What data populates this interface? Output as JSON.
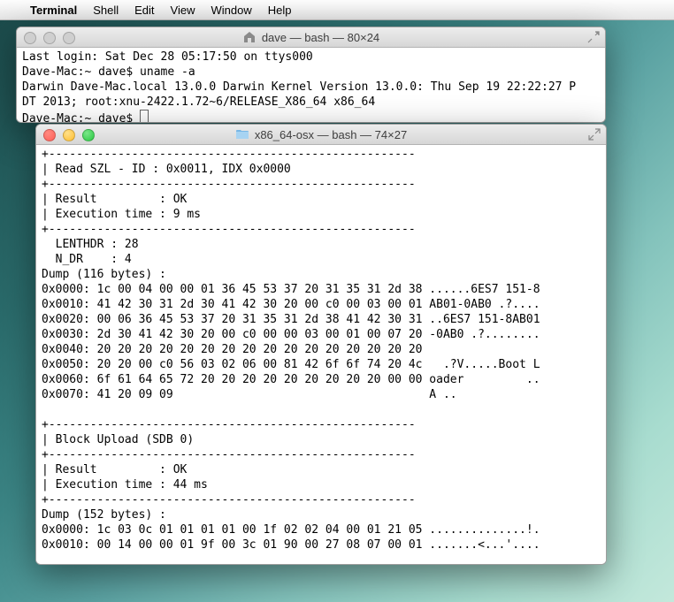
{
  "menubar": {
    "apple": "",
    "app": "Terminal",
    "items": [
      "Shell",
      "Edit",
      "View",
      "Window",
      "Help"
    ]
  },
  "win1": {
    "title": "dave — bash — 80×24",
    "lines": [
      "Last login: Sat Dec 28 05:17:50 on ttys000",
      "Dave-Mac:~ dave$ uname -a",
      "Darwin Dave-Mac.local 13.0.0 Darwin Kernel Version 13.0.0: Thu Sep 19 22:22:27 P",
      "DT 2013; root:xnu-2422.1.72~6/RELEASE_X86_64 x86_64",
      "Dave-Mac:~ dave$ "
    ]
  },
  "win2": {
    "title": "x86_64-osx — bash — 74×27",
    "lines": [
      "+-----------------------------------------------------",
      "| Read SZL - ID : 0x0011, IDX 0x0000",
      "+-----------------------------------------------------",
      "| Result         : OK",
      "| Execution time : 9 ms",
      "+-----------------------------------------------------",
      "  LENTHDR : 28",
      "  N_DR    : 4",
      "Dump (116 bytes) :",
      "0x0000: 1c 00 04 00 00 01 36 45 53 37 20 31 35 31 2d 38 ......6ES7 151-8",
      "0x0010: 41 42 30 31 2d 30 41 42 30 20 00 c0 00 03 00 01 AB01-0AB0 .?....",
      "0x0020: 00 06 36 45 53 37 20 31 35 31 2d 38 41 42 30 31 ..6ES7 151-8AB01",
      "0x0030: 2d 30 41 42 30 20 00 c0 00 00 03 00 01 00 07 20 -0AB0 .?........",
      "0x0040: 20 20 20 20 20 20 20 20 20 20 20 20 20 20 20 20",
      "0x0050: 20 20 00 c0 56 03 02 06 00 81 42 6f 6f 74 20 4c   .?V.....Boot L",
      "0x0060: 6f 61 64 65 72 20 20 20 20 20 20 20 20 20 00 00 oader         ..",
      "0x0070: 41 20 09 09                                     A ..",
      "",
      "+-----------------------------------------------------",
      "| Block Upload (SDB 0)",
      "+-----------------------------------------------------",
      "| Result         : OK",
      "| Execution time : 44 ms",
      "+-----------------------------------------------------",
      "Dump (152 bytes) :",
      "0x0000: 1c 03 0c 01 01 01 01 00 1f 02 02 04 00 01 21 05 ..............!.",
      "0x0010: 00 14 00 00 01 9f 00 3c 01 90 00 27 08 07 00 01 .......<...'...."
    ]
  }
}
